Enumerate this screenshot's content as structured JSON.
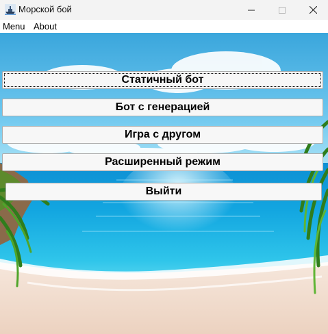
{
  "window": {
    "title": "Морской бой"
  },
  "menu": {
    "items": [
      "Menu",
      "About"
    ]
  },
  "buttons": {
    "static_bot": "Статичный бот",
    "generation_bot": "Бот с генерацией",
    "friend_game": "Игра с другом",
    "extended_mode": "Расширенный режим",
    "exit": "Выйти"
  }
}
